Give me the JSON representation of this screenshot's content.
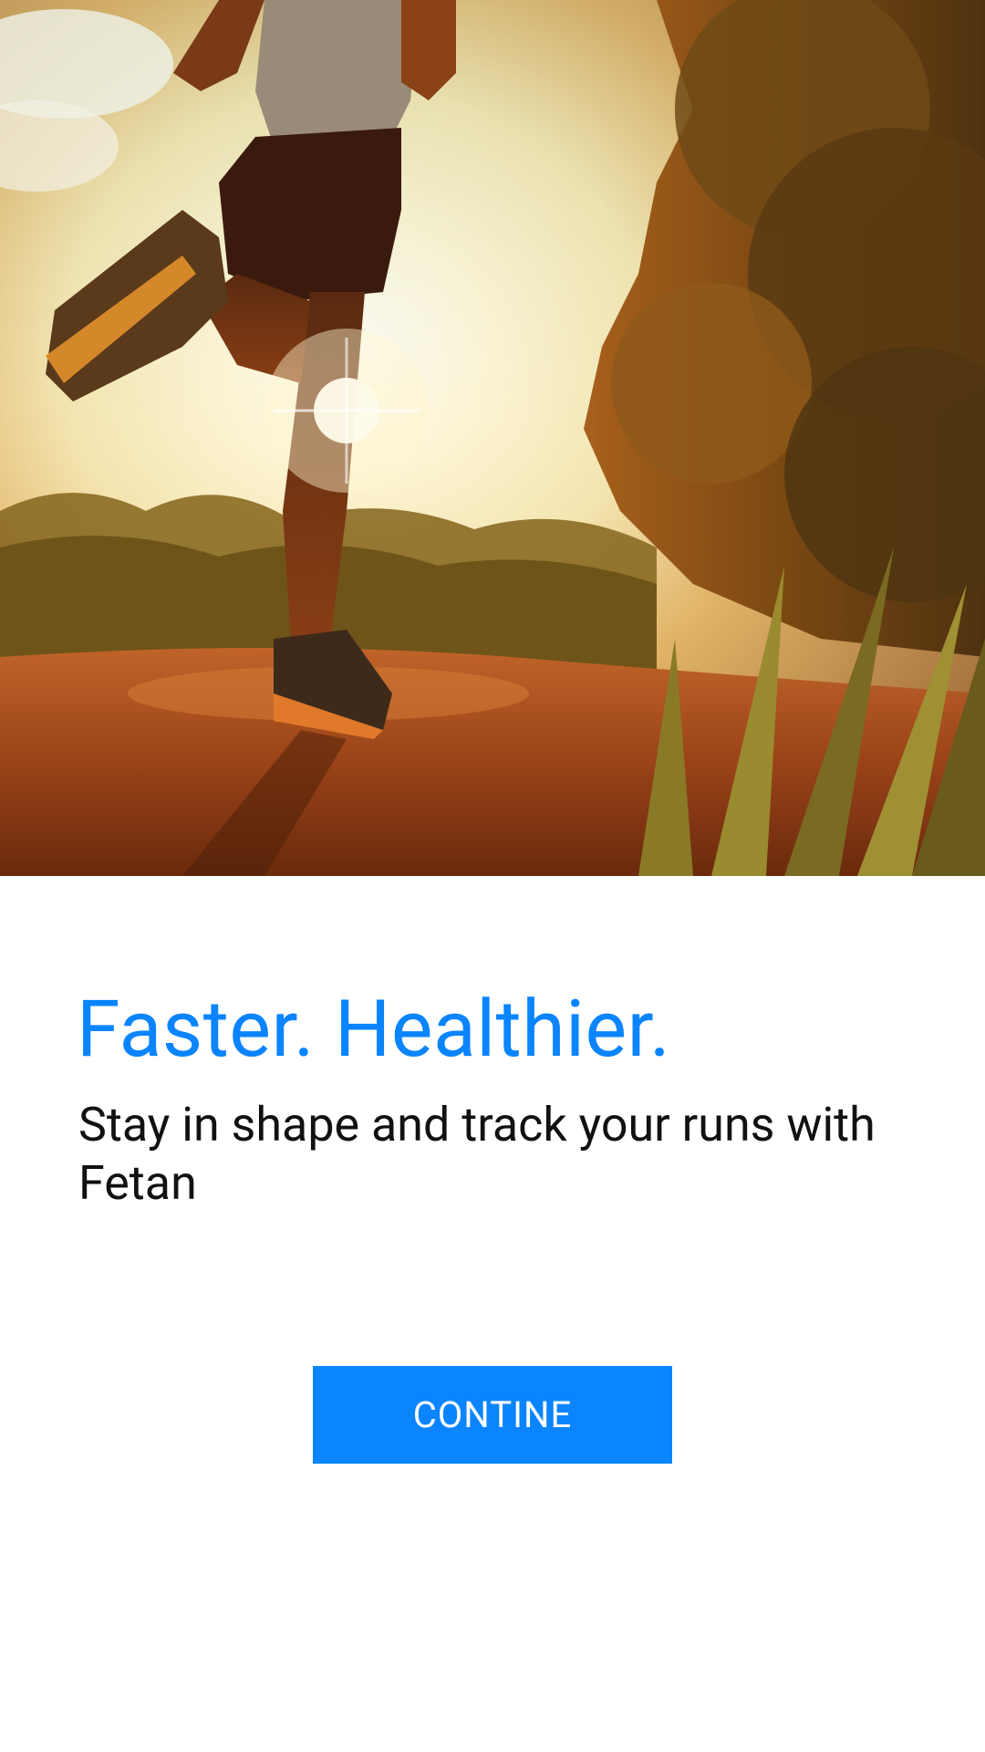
{
  "hero": {
    "image": "runner-on-dirt-trail-at-sunset-photo"
  },
  "onboarding": {
    "headline": "Faster. Healthier.",
    "subtitle": "Stay in shape and track your runs with Fetan",
    "cta_label": "CONTINE"
  },
  "colors": {
    "accent": "#0a84ff",
    "text": "#111111",
    "background": "#ffffff"
  }
}
